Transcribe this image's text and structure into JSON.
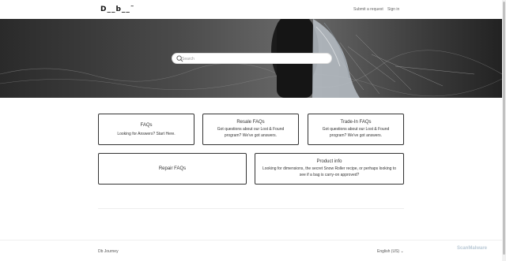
{
  "header": {
    "logo": "D__b__˜",
    "nav": {
      "submit_request": "Submit a request",
      "sign_in": "Sign in"
    }
  },
  "search": {
    "placeholder": "Search"
  },
  "cards": [
    {
      "title": "FAQs",
      "description": "Looking for Answers? Start Here."
    },
    {
      "title": "Resale FAQs",
      "description": "Got questions about our Lost & Found program? We've got answers."
    },
    {
      "title": "Trade-In FAQs",
      "description": "Got questions about our Lost & Found program? We've got answers."
    },
    {
      "title": "Repair FAQs",
      "description": ""
    },
    {
      "title": "Product info",
      "description": "Looking for dimensions, the secret Snow Roller recipe, or perhaps looking to see if a bag is carry-on approved?"
    }
  ],
  "footer": {
    "brand": "Db Journey",
    "language": "English (US) ⌄"
  },
  "watermark": "ScanMalware",
  "colors": {
    "hero_dark": "#2a2a2a",
    "card_border": "#333333",
    "link_gray": "#666666"
  }
}
